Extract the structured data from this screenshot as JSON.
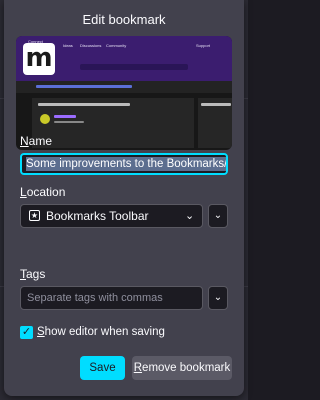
{
  "dialog": {
    "title": "Edit bookmark",
    "preview": {
      "site_logo": "m",
      "nav": {
        "brand": "Connect",
        "items": [
          "Ideas",
          "Discussions",
          "Community"
        ],
        "right": "Support"
      }
    },
    "name": {
      "label_underlined": "N",
      "label_rest": "ame",
      "value": "Some improvements to the Bookmarks/Library vi"
    },
    "location": {
      "label_underlined": "L",
      "label_rest": "ocation",
      "value": "Bookmarks Toolbar",
      "icon": "star-icon"
    },
    "tags": {
      "label_underlined": "T",
      "label_rest": "ags",
      "placeholder": "Separate tags with commas"
    },
    "show_editor": {
      "label_underlined": "S",
      "label_rest": "how editor when saving",
      "checked": true
    },
    "buttons": {
      "save": "Save",
      "remove_underlined": "R",
      "remove_rest": "emove bookmark"
    }
  },
  "colors": {
    "accent": "#00ddff",
    "panel": "#42414d",
    "field": "#1c1b22",
    "preview_header": "#3b1d6f"
  }
}
